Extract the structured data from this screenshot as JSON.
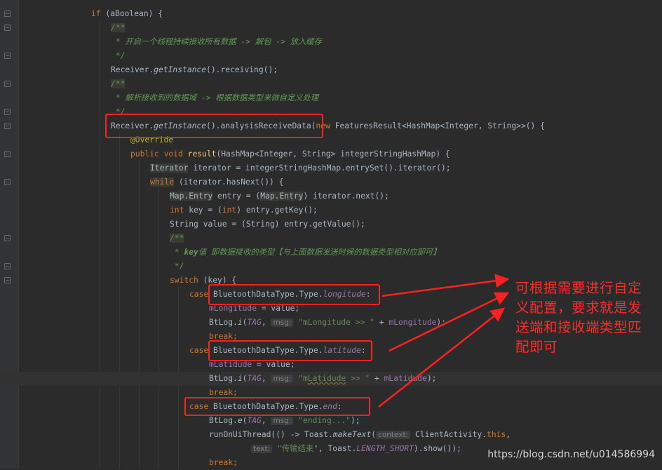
{
  "code": {
    "l1_if": "if",
    "l1_rest": " (aBoolean) {",
    "l2": "/**",
    "l3": " * 开启一个线程持续接收所有数据 -> 解包 -> 放入缓存",
    "l4": " */",
    "l5_a": "Receiver.",
    "l5_fn": "getInstance",
    "l5_b": "().receiving();",
    "l6": "/**",
    "l7": " * 解析接收到的数据域 -> 根据数据类型来做自定义处理",
    "l8": " */",
    "l9_a": "Receiver.",
    "l9_fn": "getInstance",
    "l9_b": "().analysisReceiveData(",
    "l9_new": "new",
    "l9_c": " FeaturesResult<HashMap<Integer, String>>() {",
    "l10": "@Override",
    "l11_kw": "public void",
    "l11_fn": "result",
    "l11_b": "(HashMap<Integer, String> integerStringHashMap) {",
    "l12_t": "Iterator",
    "l12_b": " iterator = integerStringHashMap.entrySet().iterator();",
    "l13_kw": "while",
    "l13_b": " (iterator.hasNext()) {",
    "l14_t": "Map.Entry",
    "l14_b": " entry = (",
    "l14_t2": "Map.Entry",
    "l14_c": ") iterator.next();",
    "l15_kw": "int",
    "l15_b": " key = (",
    "l15_kw2": "int",
    "l15_c": ") entry.getKey();",
    "l16": "String value = (String) entry.getValue();",
    "l17": "/**",
    "l18_a": " * ",
    "l18_tag": "key",
    "l18_b": "值 即数据接收的类型【与上面数据发送时候的数据类型相对应即可】",
    "l19": " */",
    "l20_kw": "switch",
    "l20_b": " (key) {",
    "l21_kw": "case",
    "l21_b": "BluetoothDataType.Type.",
    "l21_f": "longitude",
    "l21_c": ":",
    "l22_f": "mLongitude",
    "l22_b": " = value;",
    "l23_a": "BtLog.",
    "l23_fn": "i",
    "l23_b": "(",
    "l23_tag": "TAG",
    "l23_c": ", ",
    "l23_hint": "msg:",
    "l23_s": "\"mLongitude >> \"",
    "l23_d": " + ",
    "l23_f": "mLongitude",
    "l23_e": ");",
    "l24": "break;",
    "l25_kw": "case",
    "l25_b": "BluetoothDataType.Type.",
    "l25_f": "latitude",
    "l25_c": ":",
    "l26_f": "mLatidude",
    "l26_b": " = value;",
    "l27_a": "BtLog.",
    "l27_fn": "i",
    "l27_b": "(",
    "l27_tag": "TAG",
    "l27_c": ", ",
    "l27_hint": "msg:",
    "l27_s1": "\"m",
    "l27_s2": "Latidude",
    "l27_s3": " >> \"",
    "l27_d": " + ",
    "l27_f": "mLatidude",
    "l27_e": ");",
    "l28": "break;",
    "l29_kw": "case",
    "l29_b": "BluetoothDataType.Type.",
    "l29_f": "end",
    "l29_c": ":",
    "l30_a": "BtLog.",
    "l30_fn": "e",
    "l30_b": "(",
    "l30_tag": "TAG",
    "l30_c": ", ",
    "l30_hint": "msg:",
    "l30_s": "\"ending...\"",
    "l30_e": ");",
    "l31_a": "runOnUiThread(() -> Toast.",
    "l31_fn": "makeText",
    "l31_b": "(",
    "l31_hint": "context:",
    "l31_c": "ClientActivity.",
    "l31_this": "this",
    "l31_d": ",",
    "l32_hint": "text:",
    "l32_s": "\"传输结束\"",
    "l32_b": ", Toast.",
    "l32_f": "LENGTH_SHORT",
    "l32_c": ").show());",
    "l33": "break;"
  },
  "annotation": {
    "note": "可根据需要进行自定义配置，要求就是发送端和接收端类型匹配即可",
    "color": "#ff2a2a"
  },
  "watermark": "https://blog.csdn.net/u014586994"
}
